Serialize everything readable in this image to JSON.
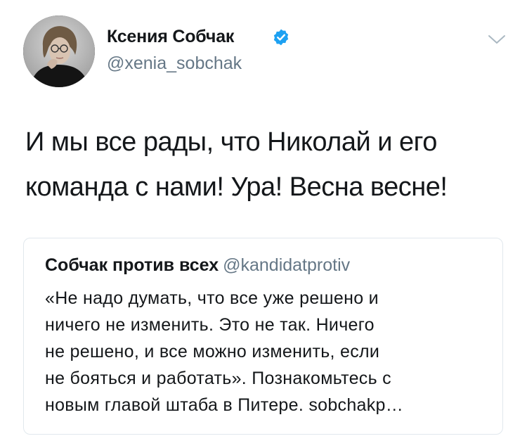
{
  "author": {
    "display_name": "Ксения Собчак",
    "handle": "@xenia_sobchak",
    "verified": true,
    "avatar_icon": "profile-photo"
  },
  "tweet": {
    "text_lines": [
      "И мы все рады, что Николай и его",
      "команда с нами! Ура! Весна весне!"
    ]
  },
  "quoted_tweet": {
    "display_name": "Собчак против всех",
    "handle": "@kandidatprotiv",
    "text_lines": [
      "«Не надо думать, что все уже решено и",
      "ничего не изменить. Это не так. Ничего",
      "не решено, и все можно изменить, если",
      "не бояться и работать». Познакомьтесь с",
      "новым главой штаба в Питере. sobchakp…"
    ]
  },
  "colors": {
    "text_primary": "#14171a",
    "text_secondary": "#657786",
    "verified_blue": "#1da1f2",
    "border": "#e1e8ed"
  }
}
